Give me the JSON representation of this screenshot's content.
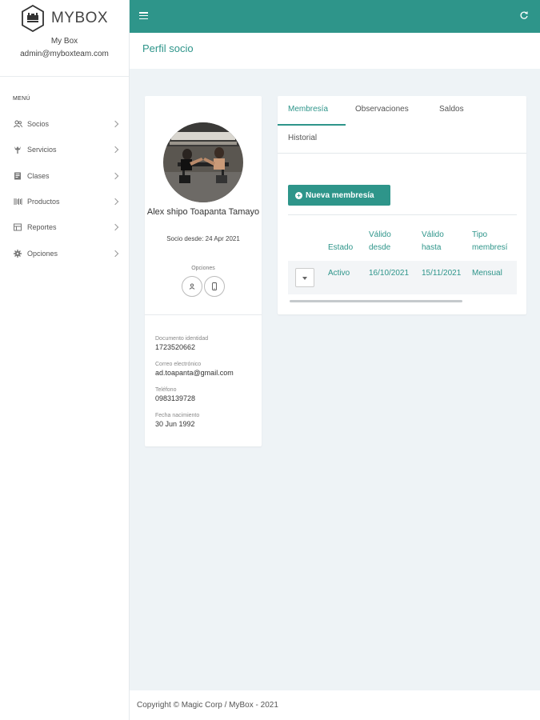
{
  "app": {
    "name": "MYBOX",
    "account_name": "My Box",
    "account_email": "admin@myboxteam.com",
    "logo_text": "MYBOX"
  },
  "sidebar": {
    "menu_title": "MENÚ",
    "items": [
      {
        "label": "Socios",
        "icon": "users-icon"
      },
      {
        "label": "Servicios",
        "icon": "services-icon"
      },
      {
        "label": "Clases",
        "icon": "classes-icon"
      },
      {
        "label": "Productos",
        "icon": "products-icon"
      },
      {
        "label": "Reportes",
        "icon": "reports-icon"
      },
      {
        "label": "Opciones",
        "icon": "gear-icon"
      }
    ]
  },
  "header": {
    "page_title": "Perfil socio"
  },
  "profile": {
    "name": "Alex shipo Toapanta Tamayo",
    "member_since": "Socio desde: 24 Apr 2021",
    "options_label": "Opciones",
    "fields": [
      {
        "label": "Documento identidad",
        "value": "1723520662"
      },
      {
        "label": "Correo electrónico",
        "value": "ad.toapanta@gmail.com"
      },
      {
        "label": "Teléfono",
        "value": "0983139728"
      },
      {
        "label": "Fecha nacimiento",
        "value": "30 Jun 1992"
      }
    ]
  },
  "membership": {
    "tabs": [
      "Membresía",
      "Observaciones",
      "Saldos",
      "Historial"
    ],
    "new_button": "Nueva membresía",
    "columns": [
      "Estado",
      "Válido desde",
      "Válido hasta",
      "Tipo membresí"
    ],
    "rows": [
      {
        "estado": "Activo",
        "desde": "16/10/2021",
        "hasta": "15/11/2021",
        "tipo": "Mensual"
      }
    ]
  },
  "footer": {
    "text": "Copyright © Magic Corp / MyBox - 2021"
  },
  "colors": {
    "accent": "#2e958a",
    "background": "#eef3f6"
  }
}
